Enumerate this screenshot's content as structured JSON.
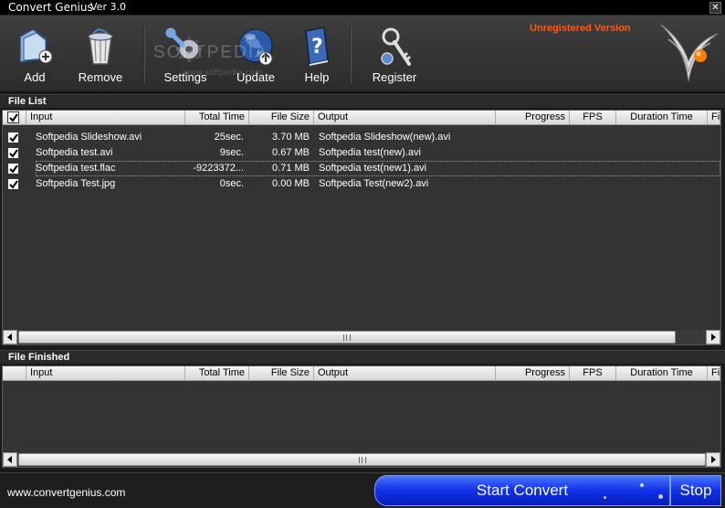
{
  "window": {
    "title": "Convert Genius",
    "version": "Ver 3.0",
    "close_glyph": "✕",
    "unregistered_label": "Unregistered Version"
  },
  "toolbar": {
    "add": {
      "label": "Add",
      "icon": "folder-add-icon"
    },
    "remove": {
      "label": "Remove",
      "icon": "trash-bin-icon"
    },
    "settings": {
      "label": "Settings",
      "icon": "wrench-gear-icon"
    },
    "update": {
      "label": "Update",
      "icon": "globe-update-icon"
    },
    "help": {
      "label": "Help",
      "icon": "help-book-icon"
    },
    "register": {
      "label": "Register",
      "icon": "key-icon"
    }
  },
  "watermark": {
    "main": "SOFTPEDIA",
    "sub": "www.softpedia.com"
  },
  "file_list": {
    "section_label": "File List",
    "columns": [
      "Input",
      "Total Time",
      "File Size",
      "Output",
      "Progress",
      "FPS",
      "Duration Time",
      "Fi"
    ],
    "rows": [
      {
        "checked": true,
        "input": "Softpedia Slideshow.avi",
        "total_time": "25sec.",
        "file_size": "3.70 MB",
        "output": "Softpedia Slideshow(new).avi",
        "progress": "",
        "fps": "",
        "duration": ""
      },
      {
        "checked": true,
        "input": "Softpedia test.avi",
        "total_time": "9sec.",
        "file_size": "0.67 MB",
        "output": "Softpedia test(new).avi",
        "progress": "",
        "fps": "",
        "duration": ""
      },
      {
        "checked": true,
        "input": "Softpedia test.flac",
        "total_time": "-9223372...",
        "file_size": "0.71 MB",
        "output": "Softpedia test(new1).avi",
        "progress": "",
        "fps": "",
        "duration": ""
      },
      {
        "checked": true,
        "input": "Softpedia Test.jpg",
        "total_time": "0sec.",
        "file_size": "0.00 MB",
        "output": "Softpedia Test(new2).avi",
        "progress": "",
        "fps": "",
        "duration": ""
      }
    ]
  },
  "file_finished": {
    "section_label": "File Finished",
    "columns": [
      "Input",
      "Total Time",
      "File Size",
      "Output",
      "Progress",
      "FPS",
      "Duration Time",
      "Fi"
    ],
    "rows": []
  },
  "footer": {
    "website": "www.convertgenius.com",
    "start_convert_label": "Start Convert",
    "stop_label": "Stop"
  },
  "colors": {
    "accent_orange": "#ff5a0a",
    "button_blue": "#1030e8",
    "background": "#333333"
  }
}
